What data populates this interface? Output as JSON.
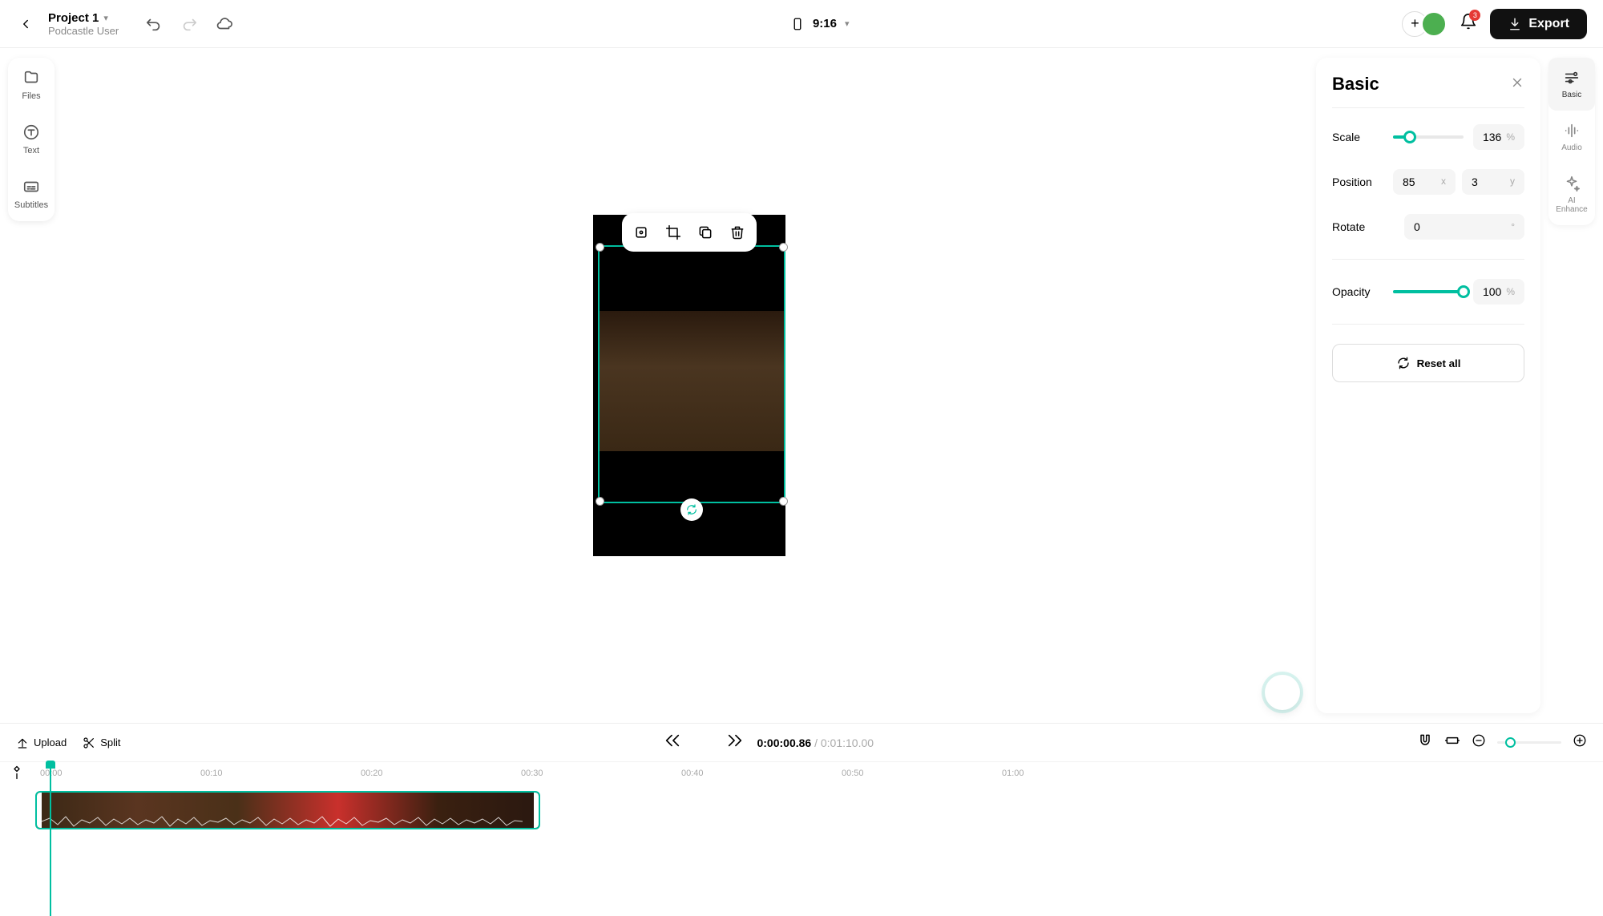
{
  "header": {
    "project_title": "Project 1",
    "project_user": "Podcastle User",
    "aspect_ratio": "9:16",
    "export_label": "Export",
    "notification_count": "3"
  },
  "left_sidebar": {
    "files": "Files",
    "text": "Text",
    "subtitles": "Subtitles"
  },
  "right_toolbar": {
    "basic": "Basic",
    "audio": "Audio",
    "ai_enhance": "AI Enhance"
  },
  "properties": {
    "title": "Basic",
    "scale_label": "Scale",
    "scale_value": "136",
    "scale_unit": "%",
    "scale_pct": 24,
    "position_label": "Position",
    "position_x": "85",
    "position_y": "3",
    "rotate_label": "Rotate",
    "rotate_value": "0",
    "rotate_unit": "°",
    "opacity_label": "Opacity",
    "opacity_value": "100",
    "opacity_unit": "%",
    "opacity_pct": 100,
    "reset_label": "Reset all"
  },
  "timeline": {
    "upload_label": "Upload",
    "split_label": "Split",
    "current_time": "0:00:00.86",
    "total_time": "0:01:10.00",
    "marks": [
      "00:00",
      "00:10",
      "00:20",
      "00:30",
      "00:40",
      "00:50",
      "01:00"
    ]
  }
}
